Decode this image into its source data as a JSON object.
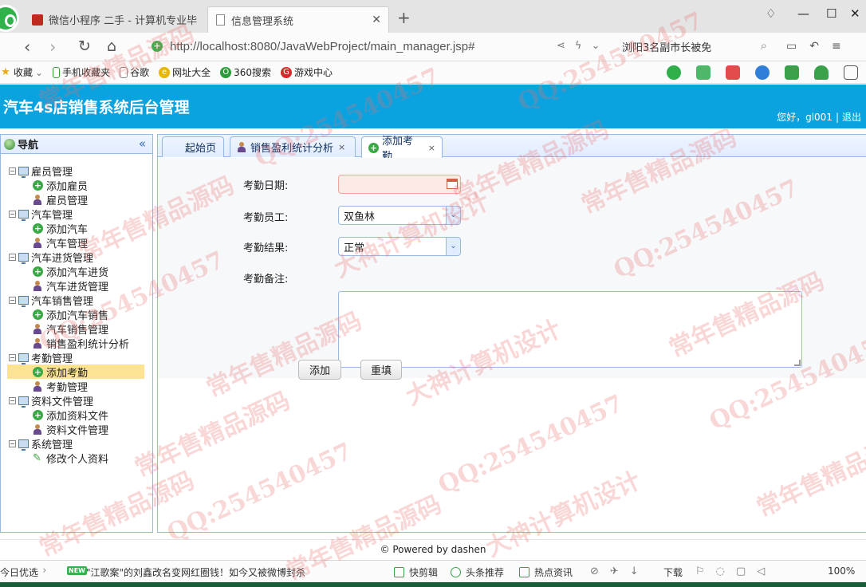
{
  "browser": {
    "tabs": [
      {
        "title": "微信小程序 二手 - 计算机专业毕",
        "active": false
      },
      {
        "title": "信息管理系统",
        "active": true
      }
    ],
    "url": "http://localhost:8080/JavaWebProject/main_manager.jsp#",
    "search_text": "浏阳3名副市长被免",
    "bookmarks": [
      {
        "label": "收藏",
        "icon": "star-icon"
      },
      {
        "label": "手机收藏夹",
        "icon": "phone-icon"
      },
      {
        "label": "谷歌",
        "icon": "page-icon"
      },
      {
        "label": "网址大全",
        "icon": "globe-icon"
      },
      {
        "label": "360搜索",
        "icon": "search-360-icon"
      },
      {
        "label": "游戏中心",
        "icon": "game-icon"
      }
    ]
  },
  "app": {
    "title": "汽车4s店销售系统后台管理",
    "greeting": "您好，gl001",
    "logout": "退出",
    "brand_color": "#0aa3df"
  },
  "nav": {
    "title": "导航",
    "groups": [
      {
        "label": "雇员管理",
        "items": [
          {
            "label": "添加雇员",
            "icon": "add-icon"
          },
          {
            "label": "雇员管理",
            "icon": "user-icon"
          }
        ]
      },
      {
        "label": "汽车管理",
        "items": [
          {
            "label": "添加汽车",
            "icon": "add-icon"
          },
          {
            "label": "汽车管理",
            "icon": "user-icon"
          }
        ]
      },
      {
        "label": "汽车进货管理",
        "items": [
          {
            "label": "添加汽车进货",
            "icon": "add-icon"
          },
          {
            "label": "汽车进货管理",
            "icon": "user-icon"
          }
        ]
      },
      {
        "label": "汽车销售管理",
        "items": [
          {
            "label": "添加汽车销售",
            "icon": "add-icon"
          },
          {
            "label": "汽车销售管理",
            "icon": "user-icon"
          },
          {
            "label": "销售盈利统计分析",
            "icon": "user-icon"
          }
        ]
      },
      {
        "label": "考勤管理",
        "items": [
          {
            "label": "添加考勤",
            "icon": "add-icon",
            "selected": true
          },
          {
            "label": "考勤管理",
            "icon": "user-icon"
          }
        ]
      },
      {
        "label": "资料文件管理",
        "items": [
          {
            "label": "添加资料文件",
            "icon": "add-icon"
          },
          {
            "label": "资料文件管理",
            "icon": "user-icon"
          }
        ]
      },
      {
        "label": "系统管理",
        "items": [
          {
            "label": "修改个人资料",
            "icon": "pencil-icon"
          }
        ]
      }
    ]
  },
  "content_tabs": [
    {
      "label": "起始页",
      "closable": false
    },
    {
      "label": "销售盈利统计分析",
      "closable": true
    },
    {
      "label": "添加考勤",
      "closable": true,
      "active": true
    }
  ],
  "form": {
    "date_label": "考勤日期:",
    "date_value": "",
    "employee_label": "考勤员工:",
    "employee_value": "双鱼林",
    "result_label": "考勤结果:",
    "result_value": "正常",
    "memo_label": "考勤备注:",
    "memo_value": "",
    "add_button": "添加",
    "reset_button": "重填"
  },
  "footer": {
    "text": "© Powered by dashen"
  },
  "statusbar": {
    "left_text": "今日优选",
    "news_badge": "NEW",
    "news": "\"江歌案\"的刘鑫改名变网红圈钱！如今又被微博封杀",
    "items": [
      "快剪辑",
      "头条推荐",
      "热点资讯"
    ],
    "download": "下载",
    "zoom": "100%"
  },
  "watermark": [
    "QQ:254540457",
    "常年售精品源码",
    "大神计算机设计"
  ]
}
